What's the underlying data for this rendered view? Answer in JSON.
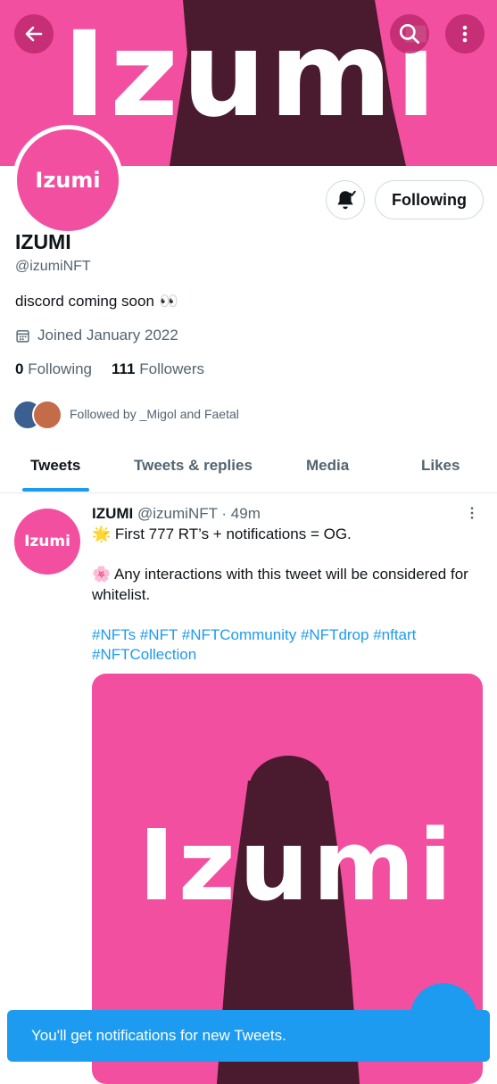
{
  "colors": {
    "brand_pink": "#f24fa0",
    "accent_blue": "#1d9bf0",
    "text": "#0f1419",
    "muted": "#536471"
  },
  "header": {
    "banner_text": "Izumi",
    "back_icon": "arrow-left-icon",
    "search_icon": "search-icon",
    "more_icon": "more-vertical-icon"
  },
  "profile": {
    "avatar_text": "Izumi",
    "display_name": "IZUMI",
    "handle": "@izumiNFT",
    "bio": "discord coming soon",
    "bio_emoji": "👀",
    "joined": "Joined January 2022",
    "following_count": "0",
    "following_label": "Following",
    "followers_count": "111",
    "followers_label": "Followers",
    "followed_by": "Followed by _Migol and Faetal",
    "follow_button": "Following",
    "bell_icon": "notification-bell-on-icon"
  },
  "tabs": [
    {
      "label": "Tweets",
      "active": true
    },
    {
      "label": "Tweets & replies",
      "active": false
    },
    {
      "label": "Media",
      "active": false
    },
    {
      "label": "Likes",
      "active": false
    }
  ],
  "tweet": {
    "avatar_text": "Izumi",
    "name": "IZUMI",
    "handle": "@izumiNFT",
    "time": "· 49m",
    "line1": "🌟 First 777 RT’s + notifications = OG.",
    "line2": "🌸 Any interactions with this tweet will be considered for whitelist.",
    "hashtags": "#NFTs #NFT #NFTCommunity #NFTdrop #nftart #NFTCollection",
    "media_text": "Izumi"
  },
  "toast": {
    "text": "You'll get notifications for new Tweets."
  }
}
